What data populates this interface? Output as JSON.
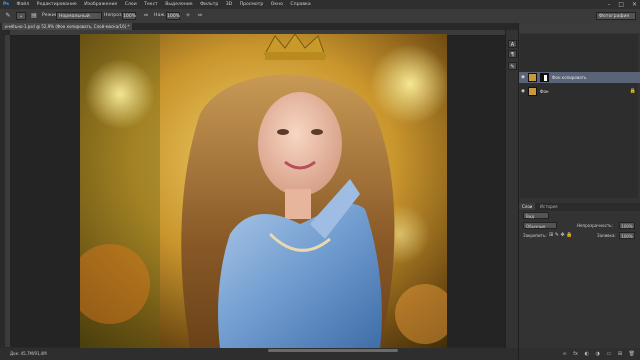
{
  "app": {
    "logo": "Ps",
    "menus": [
      "Файл",
      "Редактирование",
      "Изображение",
      "Слои",
      "Текст",
      "Выделение",
      "Фильтр",
      "3D",
      "Просмотр",
      "Окно",
      "Справка"
    ],
    "window_buttons": [
      "–",
      "□",
      "✕"
    ]
  },
  "options": {
    "mode_label": "Режим:",
    "mode_value": "Нормальный",
    "opacity_label": "Непрозр.:",
    "opacity_value": "100%",
    "flow_label": "Наж.:",
    "flow_value": "100%",
    "workspace": "Фотография"
  },
  "document": {
    "tab_label": "и-мбъно-1.psd @ 52,9% (Фон копировать, Слой-маска/16) *",
    "zoom_status": "Док: 45,7М/91,4М"
  },
  "panels": {
    "nav_tabs": [
      "Слои",
      "История"
    ],
    "kind_label": "Вид",
    "blend_mode": "Обычные",
    "opacity_label": "Непрозрачность:",
    "opacity_value": "100%",
    "lock_label": "Закрепить:",
    "fill_label": "Заливка:",
    "fill_value": "100%",
    "layers": [
      {
        "name": "Фон копировать",
        "selected": true,
        "has_mask": true,
        "locked": false
      },
      {
        "name": "Фон",
        "selected": false,
        "has_mask": false,
        "locked": true
      }
    ],
    "footer_icons": [
      "link-icon",
      "fx-icon",
      "mask-icon",
      "adjustment-icon",
      "folder-icon",
      "new-layer-icon",
      "trash-icon"
    ]
  },
  "colors": {
    "bg": "#282828",
    "panel": "#333333",
    "selection": "#5a6478",
    "accent": "#3aa0ff"
  }
}
